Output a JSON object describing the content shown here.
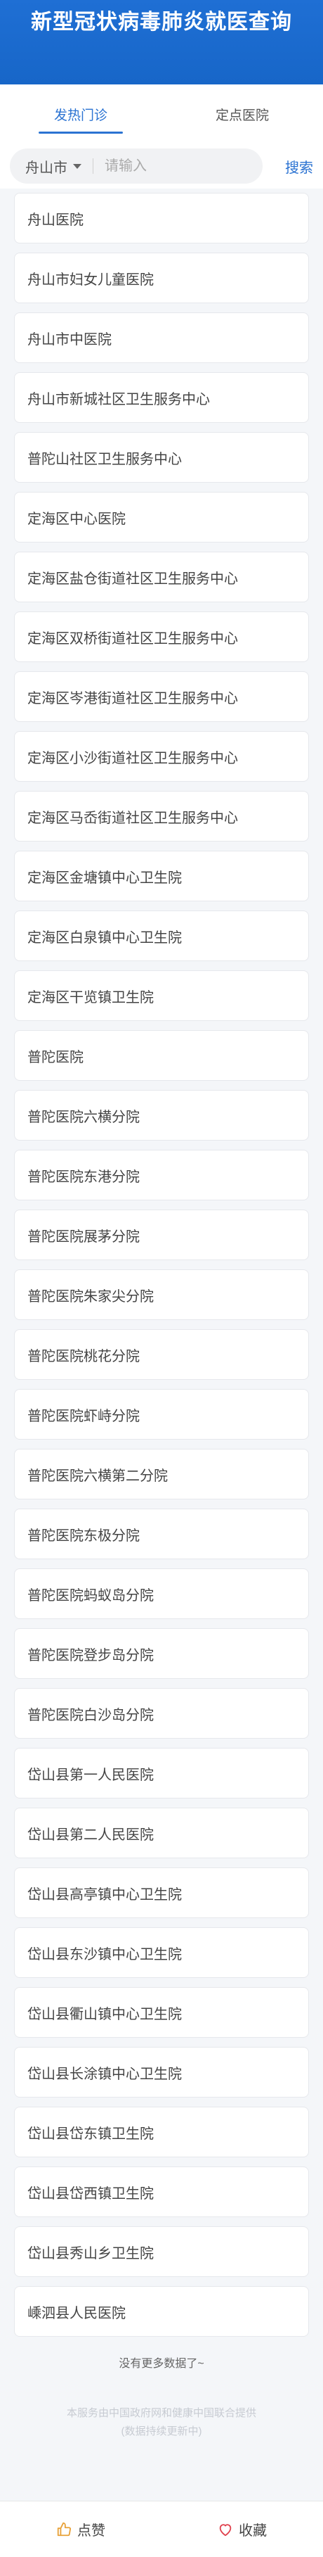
{
  "header": {
    "title": "新型冠状病毒肺炎就医查询"
  },
  "tabs": [
    {
      "label": "发热门诊"
    },
    {
      "label": "定点医院"
    }
  ],
  "search": {
    "city": "舟山市",
    "placeholder": "请输入",
    "button": "搜索"
  },
  "hospitals": [
    "舟山医院",
    "舟山市妇女儿童医院",
    "舟山市中医院",
    "舟山市新城社区卫生服务中心",
    "普陀山社区卫生服务中心",
    "定海区中心医院",
    "定海区盐仓街道社区卫生服务中心",
    "定海区双桥街道社区卫生服务中心",
    "定海区岑港街道社区卫生服务中心",
    "定海区小沙街道社区卫生服务中心",
    "定海区马岙街道社区卫生服务中心",
    "定海区金塘镇中心卫生院",
    "定海区白泉镇中心卫生院",
    "定海区干览镇卫生院",
    "普陀医院",
    "普陀医院六横分院",
    "普陀医院东港分院",
    "普陀医院展茅分院",
    "普陀医院朱家尖分院",
    "普陀医院桃花分院",
    "普陀医院虾峙分院",
    "普陀医院六横第二分院",
    "普陀医院东极分院",
    "普陀医院蚂蚁岛分院",
    "普陀医院登步岛分院",
    "普陀医院白沙岛分院",
    "岱山县第一人民医院",
    "岱山县第二人民医院",
    "岱山县高亭镇中心卫生院",
    "岱山县东沙镇中心卫生院",
    "岱山县衢山镇中心卫生院",
    "岱山县长涂镇中心卫生院",
    "岱山县岱东镇卫生院",
    "岱山县岱西镇卫生院",
    "岱山县秀山乡卫生院",
    "嵊泗县人民医院"
  ],
  "footer_note": {
    "no_more": "没有更多数据了~",
    "source_line1": "本服务由中国政府网和健康中国联合提供",
    "source_line2": "(数据持续更新中)"
  },
  "footer": {
    "like": "点赞",
    "favorite": "收藏"
  },
  "colors": {
    "brand": "#1f6fd4",
    "accent": "#2b73d2",
    "like_icon": "#e8a23a",
    "favorite_icon": "#e0434f"
  }
}
